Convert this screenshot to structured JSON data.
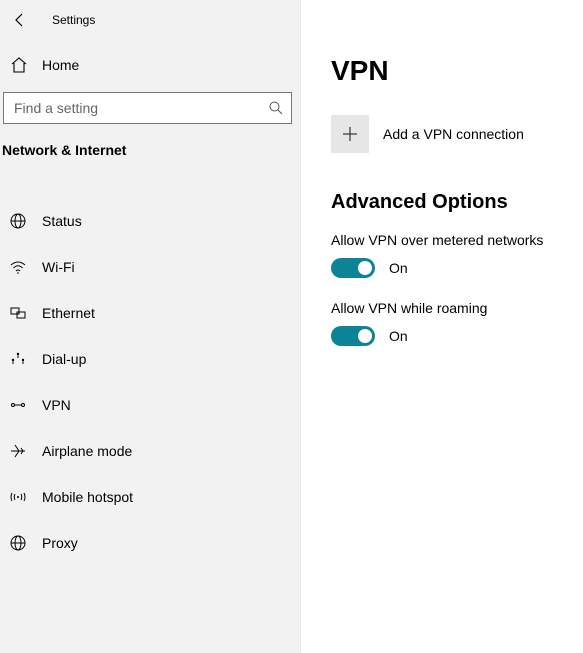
{
  "header": {
    "title": "Settings"
  },
  "sidebar": {
    "home_label": "Home",
    "search_placeholder": "Find a setting",
    "category": "Network & Internet",
    "items": [
      {
        "label": "Status"
      },
      {
        "label": "Wi-Fi"
      },
      {
        "label": "Ethernet"
      },
      {
        "label": "Dial-up"
      },
      {
        "label": "VPN"
      },
      {
        "label": "Airplane mode"
      },
      {
        "label": "Mobile hotspot"
      },
      {
        "label": "Proxy"
      }
    ]
  },
  "main": {
    "title": "VPN",
    "add_label": "Add a VPN connection",
    "advanced_title": "Advanced Options",
    "opts": [
      {
        "label": "Allow VPN over metered networks",
        "state": "On"
      },
      {
        "label": "Allow VPN while roaming",
        "state": "On"
      }
    ]
  }
}
